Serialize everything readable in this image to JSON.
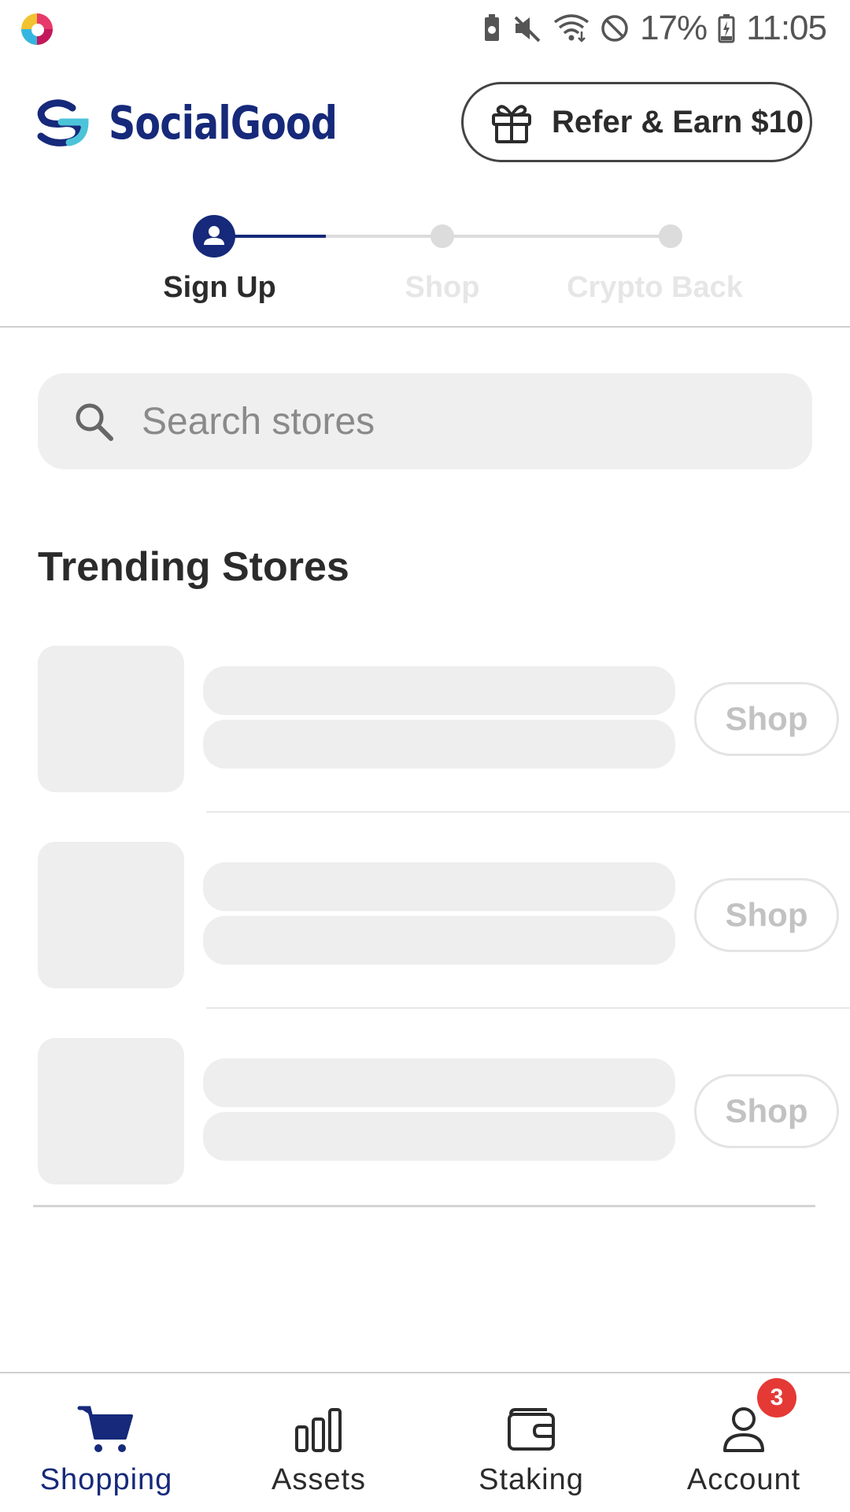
{
  "status_bar": {
    "battery": "17%",
    "time": "11:05"
  },
  "header": {
    "brand": "SocialGood",
    "refer_button": "Refer & Earn $10"
  },
  "stepper": {
    "steps": [
      {
        "label": "Sign Up",
        "state": "active"
      },
      {
        "label": "Shop",
        "state": "inactive"
      },
      {
        "label": "Crypto Back",
        "state": "inactive"
      }
    ]
  },
  "search": {
    "placeholder": "Search stores",
    "value": ""
  },
  "trending": {
    "title": "Trending Stores",
    "stores": [
      {
        "shop_label": "Shop"
      },
      {
        "shop_label": "Shop"
      },
      {
        "shop_label": "Shop"
      }
    ]
  },
  "bottom_nav": {
    "items": [
      {
        "label": "Shopping",
        "icon": "cart-icon",
        "active": true
      },
      {
        "label": "Assets",
        "icon": "bar-chart-icon",
        "active": false
      },
      {
        "label": "Staking",
        "icon": "wallet-icon",
        "active": false
      },
      {
        "label": "Account",
        "icon": "user-icon",
        "active": false
      }
    ],
    "account_badge": "3"
  },
  "colors": {
    "brand_navy": "#16297a",
    "brand_teal": "#4cc3d9",
    "badge_red": "#e53935"
  }
}
